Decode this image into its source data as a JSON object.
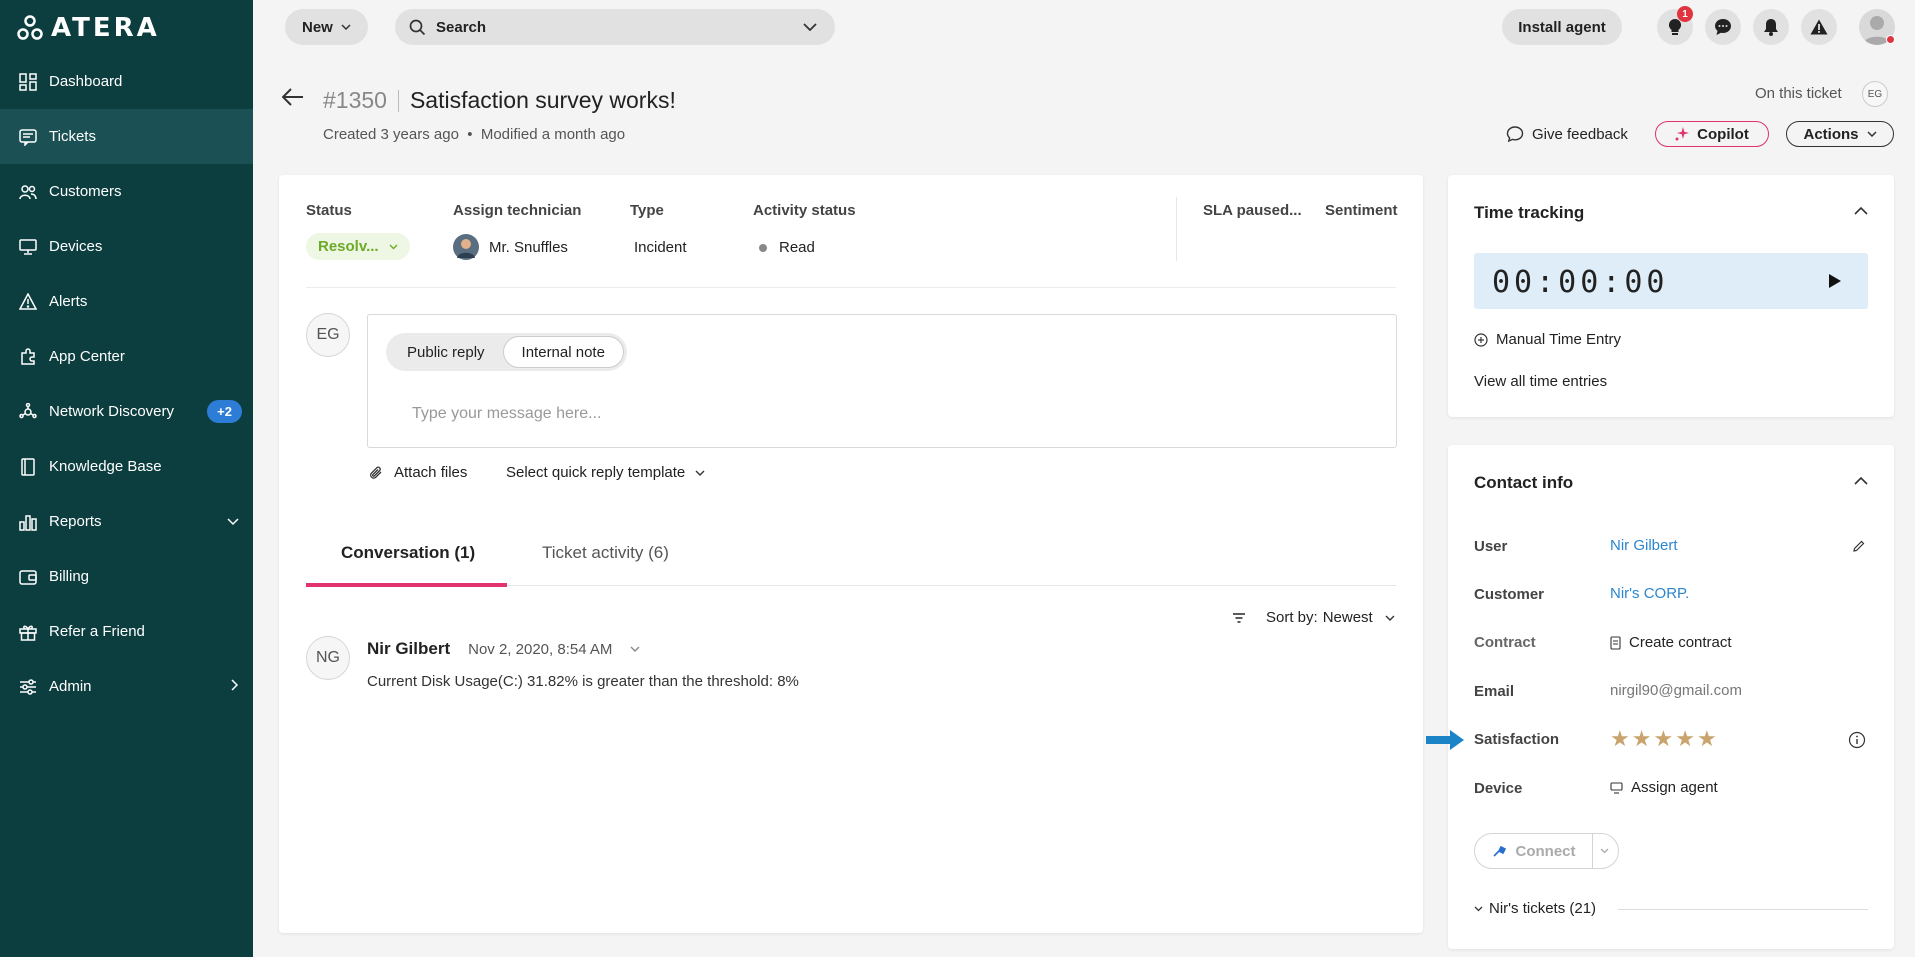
{
  "brand": {
    "name": "ATERA"
  },
  "sidebar": {
    "items": [
      {
        "label": "Dashboard"
      },
      {
        "label": "Tickets"
      },
      {
        "label": "Customers"
      },
      {
        "label": "Devices"
      },
      {
        "label": "Alerts"
      },
      {
        "label": "App Center"
      },
      {
        "label": "Network Discovery",
        "badge": "+2"
      },
      {
        "label": "Knowledge Base"
      },
      {
        "label": "Reports"
      },
      {
        "label": "Billing"
      },
      {
        "label": "Refer a Friend"
      },
      {
        "label": "Admin"
      }
    ]
  },
  "topbar": {
    "new_label": "New",
    "search_label": "Search",
    "install_agent": "Install agent",
    "notification_count": "1"
  },
  "ticket": {
    "number": "#1350",
    "title": "Satisfaction survey works!",
    "meta": "Created 3 years ago  •  Modified a month ago",
    "on_this_ticket": "On this ticket",
    "on_this_ticket_avatar": "EG",
    "give_feedback": "Give feedback",
    "copilot": "Copilot",
    "actions": "Actions"
  },
  "fields": {
    "status_label": "Status",
    "status_value": "Resolv...",
    "assign_label": "Assign technician",
    "assign_value": "Mr. Snuffles",
    "type_label": "Type",
    "type_value": "Incident",
    "activity_label": "Activity status",
    "activity_value": "Read",
    "sla_label": "SLA paused...",
    "sentiment_label": "Sentiment"
  },
  "composer": {
    "avatar": "EG",
    "public_reply": "Public reply",
    "internal_note": "Internal note",
    "placeholder": "Type your message here...",
    "attach_files": "Attach files",
    "quick_reply": "Select quick reply template"
  },
  "tabs": [
    {
      "label": "Conversation (1)"
    },
    {
      "label": "Ticket activity (6)"
    }
  ],
  "sort": {
    "label": "Sort by:",
    "value": "Newest"
  },
  "message": {
    "avatar": "NG",
    "author": "Nir Gilbert",
    "timestamp": "Nov 2, 2020, 8:54 AM",
    "body": "Current Disk Usage(C:) 31.82% is greater than the threshold: 8%"
  },
  "time_tracking": {
    "title": "Time tracking",
    "timer": "00:00:00",
    "manual_entry": "Manual Time Entry",
    "view_all": "View all time entries"
  },
  "contact": {
    "title": "Contact info",
    "user_label": "User",
    "user_value": "Nir Gilbert",
    "customer_label": "Customer",
    "customer_value": "Nir's CORP.",
    "contract_label": "Contract",
    "contract_value": "Create contract",
    "email_label": "Email",
    "email_value": "nirgil90@gmail.com",
    "satisfaction_label": "Satisfaction",
    "satisfaction_stars": 5,
    "device_label": "Device",
    "device_value": "Assign agent",
    "connect": "Connect",
    "nirs_tickets": "Nir's tickets (21)"
  },
  "colors": {
    "sidebar": "#0c3d3f",
    "accent_pink": "#e0336f",
    "link": "#2a86d1",
    "star": "#c9a46d",
    "status_green": "#6cab27",
    "arrow_blue": "#1a84c7"
  }
}
